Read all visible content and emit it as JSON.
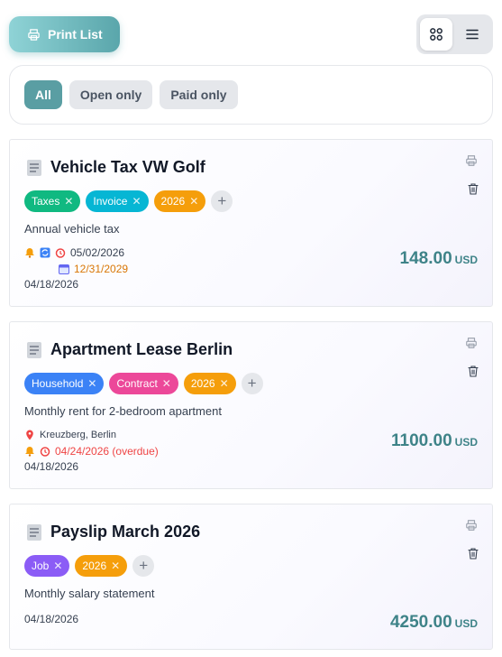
{
  "toolbar": {
    "print_label": "Print List"
  },
  "filters": [
    {
      "label": "All",
      "active": true
    },
    {
      "label": "Open only",
      "active": false
    },
    {
      "label": "Paid only",
      "active": false
    }
  ],
  "cards": [
    {
      "title": "Vehicle Tax VW Golf",
      "tags": [
        {
          "label": "Taxes",
          "color": "#10b981"
        },
        {
          "label": "Invoice",
          "color": "#06b6d4"
        },
        {
          "label": "2026",
          "color": "#f59e0b"
        }
      ],
      "description": "Annual vehicle tax",
      "reminder_date": "05/02/2026",
      "due_date": "12/31/2029",
      "created": "04/18/2026",
      "amount": "148.00",
      "currency": "USD"
    },
    {
      "title": "Apartment Lease Berlin",
      "tags": [
        {
          "label": "Household",
          "color": "#3b82f6"
        },
        {
          "label": "Contract",
          "color": "#ec4899"
        },
        {
          "label": "2026",
          "color": "#f59e0b"
        }
      ],
      "description": "Monthly rent for 2-bedroom apartment",
      "location": "Kreuzberg, Berlin",
      "reminder_date": "04/24/2026 (overdue)",
      "created": "04/18/2026",
      "amount": "1100.00",
      "currency": "USD"
    },
    {
      "title": "Payslip March 2026",
      "tags": [
        {
          "label": "Job",
          "color": "#8b5cf6"
        },
        {
          "label": "2026",
          "color": "#f59e0b"
        }
      ],
      "description": "Monthly salary statement",
      "created": "04/18/2026",
      "amount": "4250.00",
      "currency": "USD"
    }
  ]
}
